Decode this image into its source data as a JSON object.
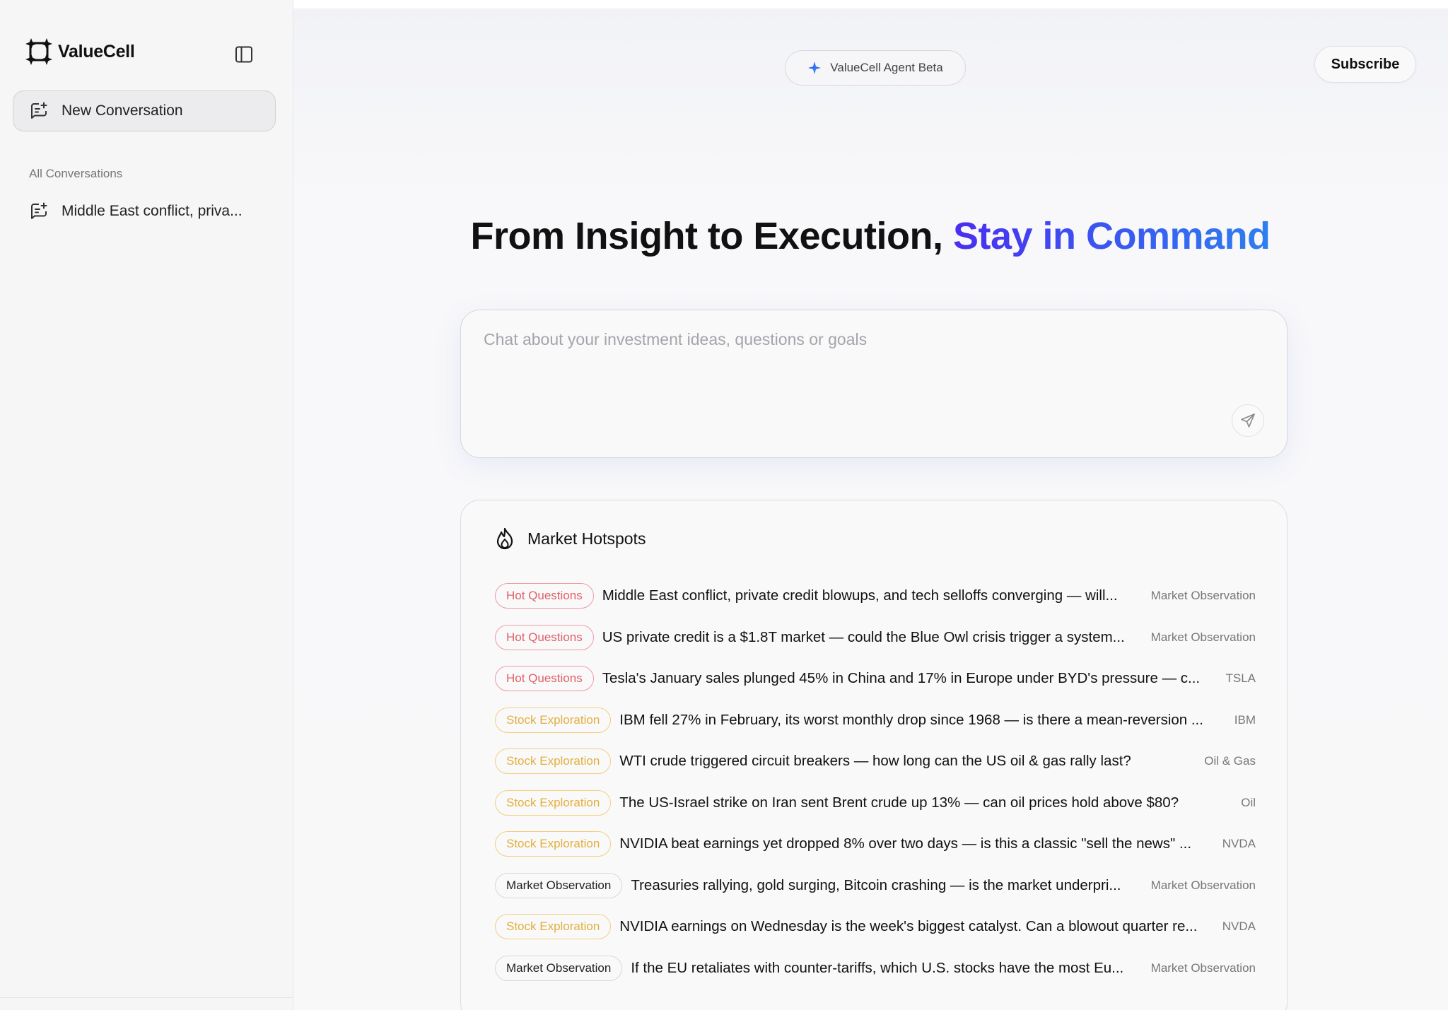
{
  "sidebar": {
    "brand": "ValueCell",
    "new_conversation": "New Conversation",
    "section_label": "All Conversations",
    "conversations": [
      {
        "title": "Middle East conflict, priva..."
      }
    ]
  },
  "header": {
    "beta_label": "ValueCell Agent Beta",
    "subscribe_label": "Subscribe"
  },
  "hero": {
    "title_main": "From Insight to Execution, ",
    "title_accent": "Stay in Command"
  },
  "chat": {
    "placeholder": "Chat about your investment ideas, questions or goals"
  },
  "hotspots": {
    "title": "Market Hotspots",
    "items": [
      {
        "tag": "Hot Questions",
        "tag_style": "hot",
        "title": "Middle East conflict, private credit blowups, and tech selloffs converging — will...",
        "category": "Market Observation"
      },
      {
        "tag": "Hot Questions",
        "tag_style": "hot",
        "title": "US private credit is a $1.8T market — could the Blue Owl crisis trigger a system...",
        "category": "Market Observation"
      },
      {
        "tag": "Hot Questions",
        "tag_style": "hot",
        "title": "Tesla's January sales plunged 45% in China and 17% in Europe under BYD's pressure — c...",
        "category": "TSLA"
      },
      {
        "tag": "Stock Exploration",
        "tag_style": "stock",
        "title": "IBM fell 27% in February, its worst monthly drop since 1968 — is there a mean-reversion ...",
        "category": "IBM"
      },
      {
        "tag": "Stock Exploration",
        "tag_style": "stock",
        "title": "WTI crude triggered circuit breakers — how long can the US oil & gas rally last?",
        "category": "Oil & Gas"
      },
      {
        "tag": "Stock Exploration",
        "tag_style": "stock",
        "title": "The US-Israel strike on Iran sent Brent crude up 13% — can oil prices hold above $80?",
        "category": "Oil"
      },
      {
        "tag": "Stock Exploration",
        "tag_style": "stock",
        "title": "NVIDIA beat earnings yet dropped 8% over two days — is this a classic \"sell the news\" ...",
        "category": "NVDA"
      },
      {
        "tag": "Market Observation",
        "tag_style": "market",
        "title": "Treasuries rallying, gold surging, Bitcoin crashing — is the market underpri...",
        "category": "Market Observation"
      },
      {
        "tag": "Stock Exploration",
        "tag_style": "stock",
        "title": "NVIDIA earnings on Wednesday is the week's biggest catalyst. Can a blowout quarter re...",
        "category": "NVDA"
      },
      {
        "tag": "Market Observation",
        "tag_style": "market",
        "title": "If the EU retaliates with counter-tariffs, which U.S. stocks have the most Eu...",
        "category": "Market Observation"
      }
    ]
  },
  "colors": {
    "accent_start": "#4a2ef0",
    "accent_end": "#2e7ff0",
    "hot_tag": "#e06068",
    "stock_tag": "#e3ae3c"
  },
  "icons": {
    "logo": "four-point-star-cluster-icon",
    "collapse": "sidebar-toggle-icon",
    "new_conversation": "chat-plus-icon",
    "beta": "sparkle-icon",
    "send": "send-icon",
    "hotspots": "flame-icon"
  }
}
